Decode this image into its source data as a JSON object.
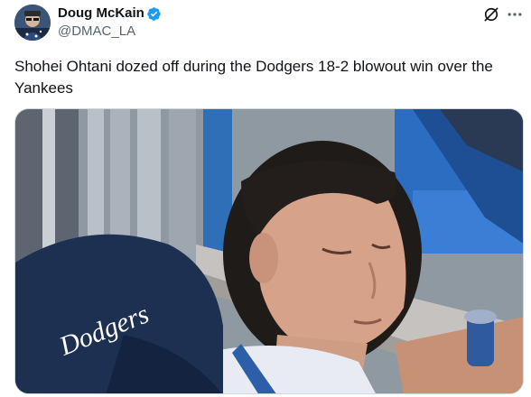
{
  "author": {
    "name": "Doug McKain",
    "handle": "@DMAC_LA",
    "verified": true
  },
  "tweet": {
    "text": "Shohei Ohtani dozed off during the Dodgers 18-2 blowout win over the Yankees"
  },
  "media": {
    "description_icon": "photo",
    "cap_logo_text": "Dodgers"
  },
  "actions": {
    "grok_icon": "grok-icon",
    "more_icon": "more-icon"
  },
  "colors": {
    "verified": "#1d9bf0",
    "handle": "#536471",
    "text": "#0f1419",
    "dodger_blue": "#1e3a6b"
  }
}
